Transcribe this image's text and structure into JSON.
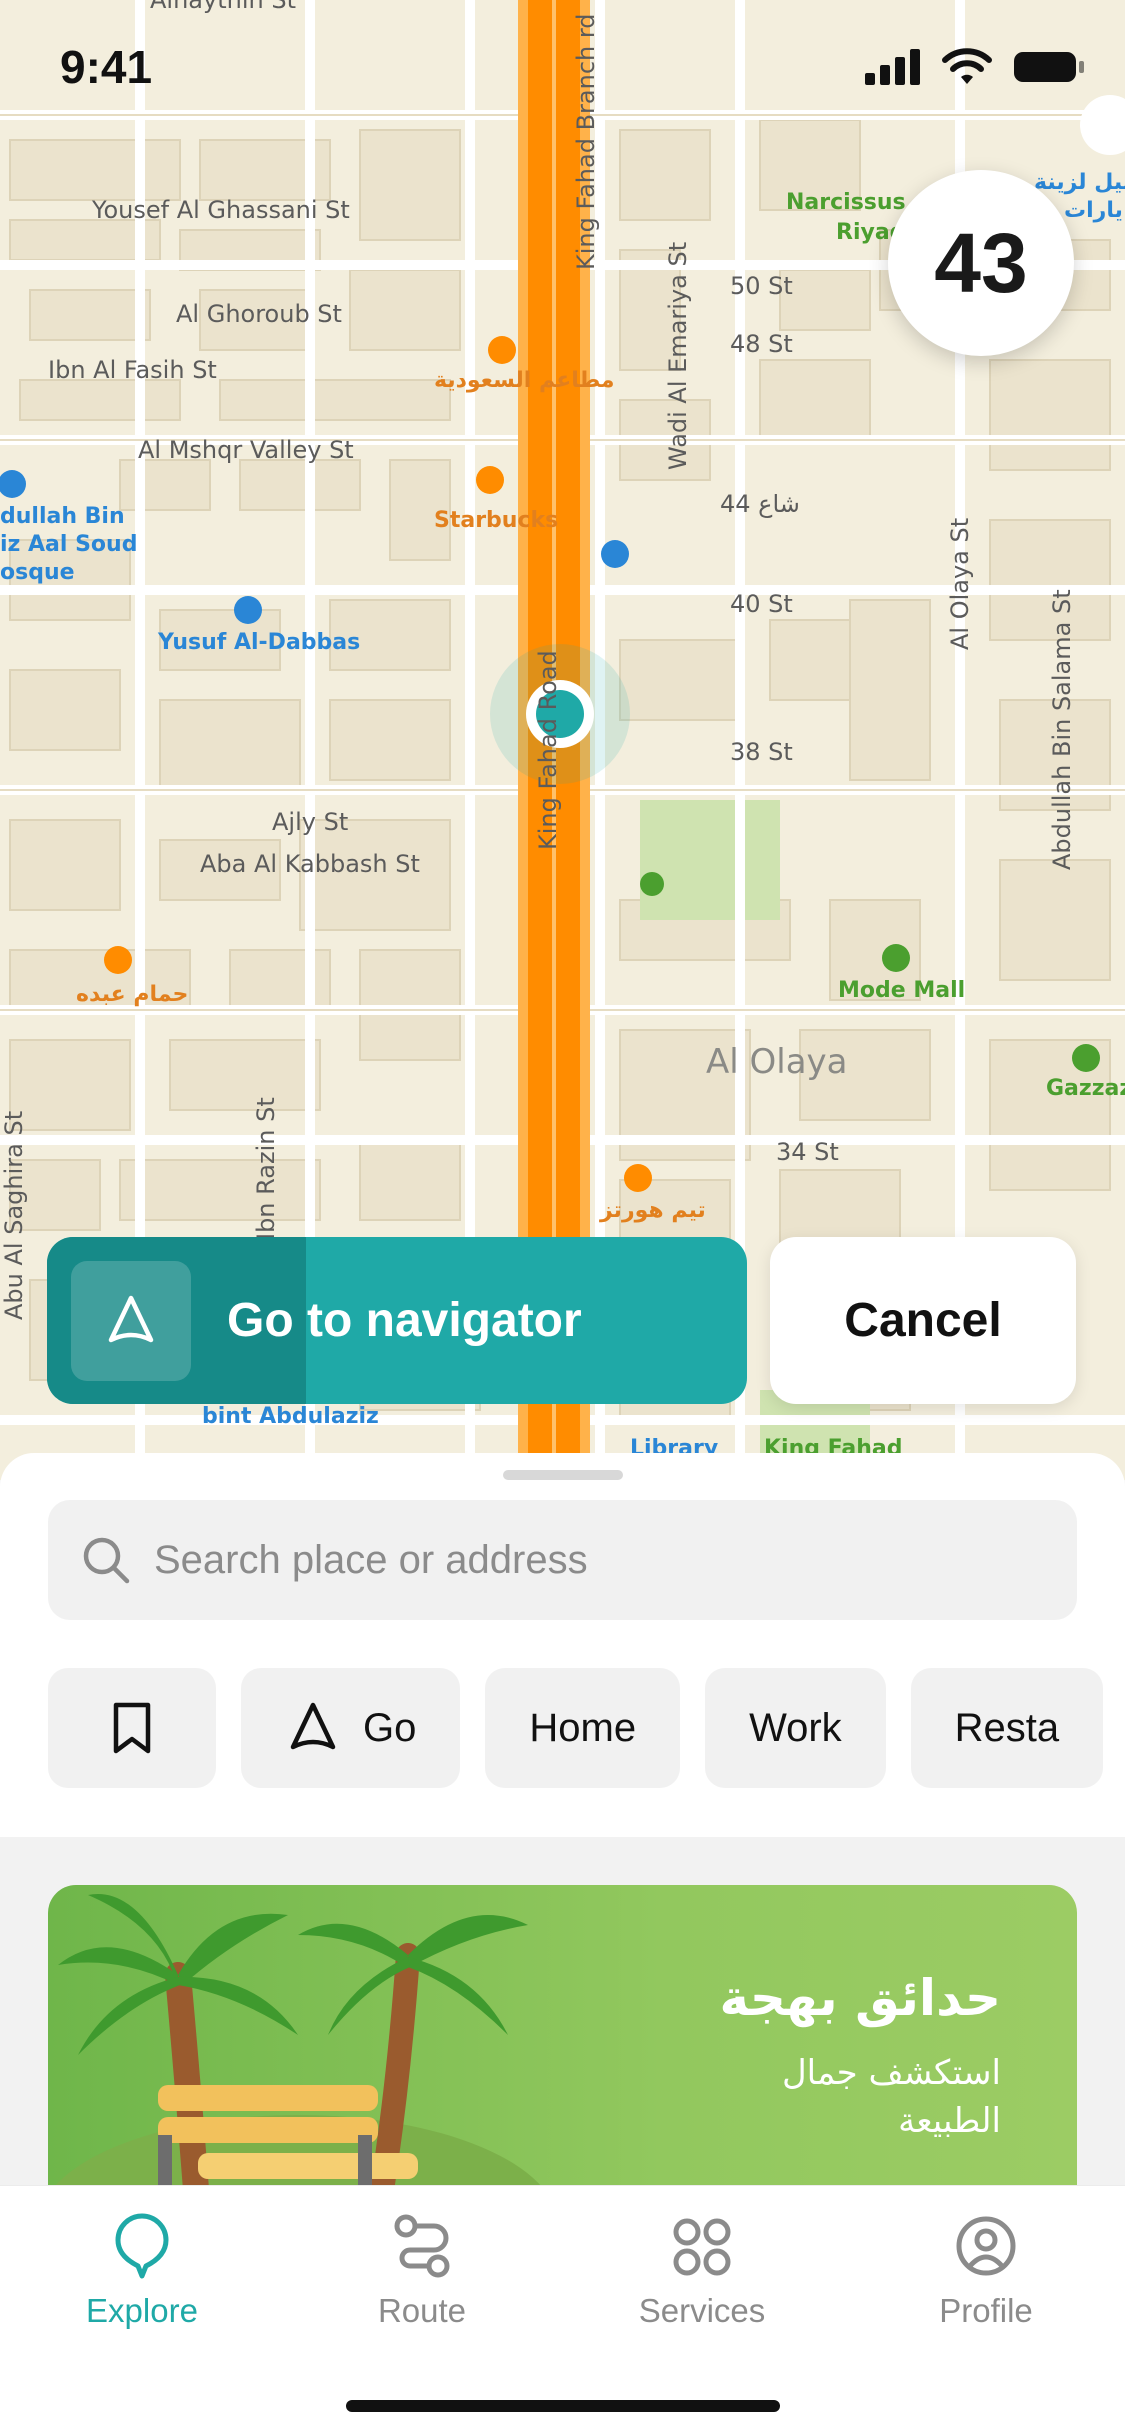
{
  "status_bar": {
    "time": "9:41"
  },
  "map": {
    "speed_value": "43",
    "streets": [
      "Alnaythin St",
      "Yousef Al Ghassani St",
      "Al Ghoroub St",
      "Ibn Al Fasih St",
      "Al Mshqr Valley St",
      "Ajly St",
      "Aba Al Kabbash St",
      "50 St",
      "48 St",
      "44 شاع",
      "40 St",
      "38 St",
      "34 St",
      "King Fahad Branch rd",
      "King Fahad Road",
      "Wadi Al Emariya St",
      "Al Olaya St",
      "Abdullah Bin Salama St",
      "Ibn Razin St",
      "Abu Al Saghira St",
      "bint Abdulaziz"
    ],
    "pois": [
      "مطاعم السعودية",
      "Starbucks",
      "Yusuf Al-Dabbas",
      "dullah Bin",
      "iz Aal Soud",
      "osque",
      "Narcissus",
      "Riyad",
      "Mode Mall",
      "Gazzaz",
      "تيم هورتز",
      "حمام عبده",
      "King Fahad",
      "Library",
      "ظليل لزينة",
      "يارات"
    ],
    "district": "Al Olaya",
    "colors": {
      "route": "#ff8c00",
      "accent": "#1fa9a7"
    }
  },
  "navigation": {
    "go_label": "Go to navigator",
    "cancel_label": "Cancel",
    "progress_fraction": 0.37
  },
  "search": {
    "placeholder": "Search place or address"
  },
  "chips": [
    {
      "icon": "bookmark-icon"
    },
    {
      "icon": "navigation-arrow-icon",
      "label": "Go"
    },
    {
      "label": "Home"
    },
    {
      "label": "Work"
    },
    {
      "label": "Resta"
    }
  ],
  "promo": {
    "title": "حدائق بهجة",
    "subtitle": "استكشف جمال الطبيعة"
  },
  "tabs": [
    {
      "label": "Explore",
      "icon": "explore-pin-icon",
      "active": true
    },
    {
      "label": "Route",
      "icon": "route-icon",
      "active": false
    },
    {
      "label": "Services",
      "icon": "services-grid-icon",
      "active": false
    },
    {
      "label": "Profile",
      "icon": "profile-icon",
      "active": false
    }
  ]
}
